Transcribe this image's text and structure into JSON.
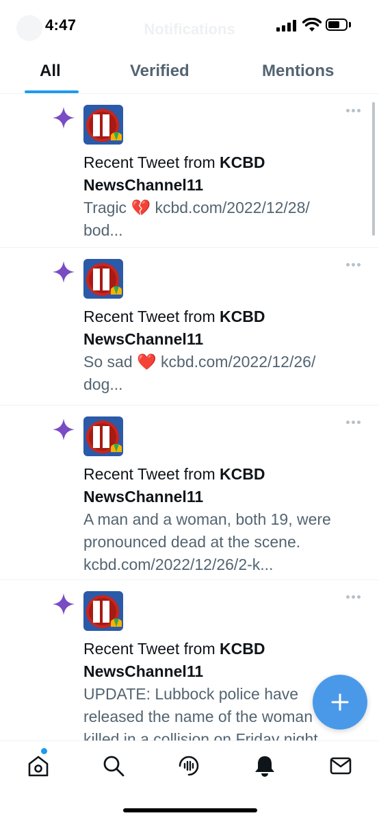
{
  "status_bar": {
    "time": "4:47",
    "ghost_title": "Notifications"
  },
  "tabs": [
    {
      "label": "All",
      "active": true
    },
    {
      "label": "Verified",
      "active": false
    },
    {
      "label": "Mentions",
      "active": false
    }
  ],
  "notifications": [
    {
      "prefix": "Recent Tweet from ",
      "account": "KCBD NewsChannel11",
      "body": [
        "Tragic 💔 kcbd.com/2022/12/28/",
        "bod..."
      ]
    },
    {
      "prefix": "Recent Tweet from ",
      "account": "KCBD NewsChannel11",
      "body": [
        "So sad ❤️ kcbd.com/2022/12/26/",
        "dog..."
      ]
    },
    {
      "prefix": "Recent Tweet from ",
      "account": "KCBD NewsChannel11",
      "body": [
        "A man and a woman, both 19, were",
        "pronounced dead at the scene.",
        "kcbd.com/2022/12/26/2-k..."
      ]
    },
    {
      "prefix": "Recent Tweet from ",
      "account": "KCBD NewsChannel11",
      "body": [
        "UPDATE: Lubbock police have",
        "released the name of the woman",
        "killed in a collision on Friday night"
      ]
    }
  ],
  "bottom_nav": [
    {
      "name": "home-icon",
      "has_badge": true
    },
    {
      "name": "search-icon"
    },
    {
      "name": "spaces-icon"
    },
    {
      "name": "notifications-bell-icon",
      "active": true
    },
    {
      "name": "messages-envelope-icon"
    }
  ],
  "colors": {
    "accent": "#1d9bf0",
    "fab": "#4a99e9",
    "sparkle": "#794bc4",
    "logo_red": "#c8261e",
    "logo_blue": "#2b5aa8"
  }
}
